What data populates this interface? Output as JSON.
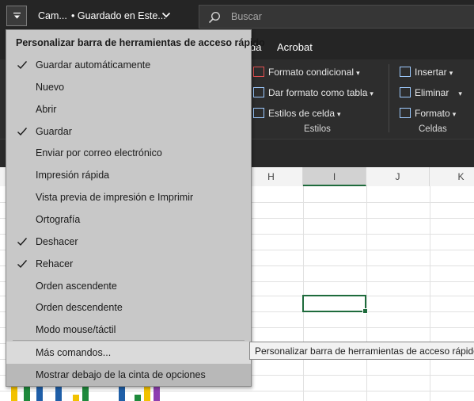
{
  "titlebar": {
    "filename": "Cam...",
    "saved_status": "• Guardado en Este...",
    "search_placeholder": "Buscar"
  },
  "ribbon": {
    "tabs": [
      "da",
      "Acrobat"
    ],
    "estilos": {
      "items": [
        "Formato condicional",
        "Dar formato como tabla",
        "Estilos de celda"
      ],
      "label": "Estilos"
    },
    "celdas": {
      "items": [
        "Insertar",
        "Eliminar",
        "Formato"
      ],
      "label": "Celdas"
    }
  },
  "grid": {
    "columns": [
      "H",
      "I",
      "J",
      "K"
    ],
    "selected_column": "I"
  },
  "menu": {
    "title": "Personalizar barra de herramientas de acceso rápido",
    "items": [
      {
        "label": "Guardar automáticamente",
        "checked": true
      },
      {
        "label": "Nuevo",
        "checked": false
      },
      {
        "label": "Abrir",
        "checked": false
      },
      {
        "label": "Guardar",
        "checked": true
      },
      {
        "label": "Enviar por correo electrónico",
        "checked": false
      },
      {
        "label": "Impresión rápida",
        "checked": false
      },
      {
        "label": "Vista previa de impresión e Imprimir",
        "checked": false
      },
      {
        "label": "Ortografía",
        "checked": false
      },
      {
        "label": "Deshacer",
        "checked": true
      },
      {
        "label": "Rehacer",
        "checked": true
      },
      {
        "label": "Orden ascendente",
        "checked": false
      },
      {
        "label": "Orden descendente",
        "checked": false
      },
      {
        "label": "Modo mouse/táctil",
        "checked": false
      }
    ],
    "more_commands": "Más comandos...",
    "show_below": "Mostrar debajo de la cinta de opciones"
  },
  "tooltip": "Personalizar barra de herramientas de acceso rápido",
  "colors": {
    "titlebar_bg": "#252525",
    "ribbon_bg": "#2d2d2d",
    "menu_bg": "#c8c8c8",
    "selection_green": "#1e6b3c"
  }
}
